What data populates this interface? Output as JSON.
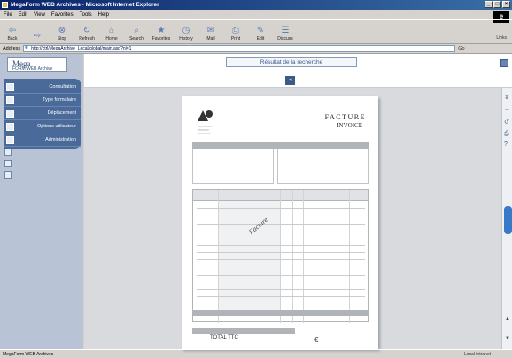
{
  "window": {
    "title": "MegaForm WEB Archives - Microsoft Internet Explorer"
  },
  "menu": [
    "File",
    "Edit",
    "View",
    "Favorites",
    "Tools",
    "Help"
  ],
  "toolbar": {
    "buttons": [
      "Back",
      "",
      "Stop",
      "Refresh",
      "Home",
      "Search",
      "Favorites",
      "History",
      "Mail",
      "Print",
      "Edit",
      "Discuss"
    ],
    "links": "Links"
  },
  "address": {
    "label": "Address",
    "url": "http://ctrl/MegaArchive_Local/global/main.asp?nl=1",
    "go": "Go"
  },
  "app": {
    "logo": {
      "name": "Mega",
      "subtitle": "FORM WEB Archive"
    },
    "nav": [
      {
        "label": "Consultation"
      },
      {
        "label": "Type formulaire"
      },
      {
        "label": "Déplacement"
      },
      {
        "label": "Options utilisateur"
      },
      {
        "label": "Administration"
      }
    ],
    "search_header": "Résultat de la recherche"
  },
  "document": {
    "title_fr": "FACTURE",
    "title_en": "INVOICE",
    "total_label": "TOTAL TTC",
    "watermark": "Facture"
  },
  "statusbar": {
    "text": "MegaForm WEB Archives",
    "zone": "Local intranet"
  }
}
